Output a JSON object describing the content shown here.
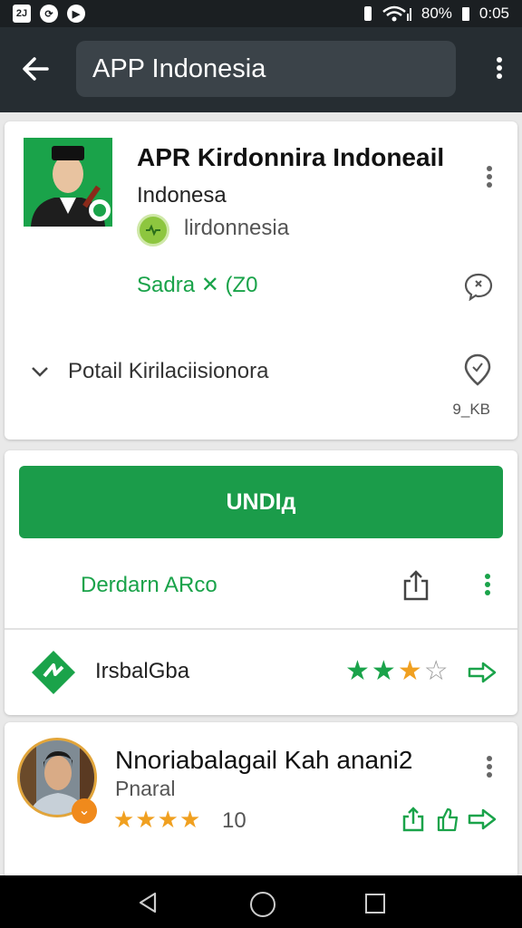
{
  "status_bar": {
    "left_icons": [
      "2J",
      "notification-icon",
      "play-icon"
    ],
    "battery": "80%",
    "time": "0:05"
  },
  "app_bar": {
    "search_value": "APP Indonesia"
  },
  "app_card": {
    "title": "APR Kirdonnira Indoneail",
    "subtitle": "Indonesa",
    "badge_label": "lirdonnesia",
    "green_text": "Sadra ✕ (Z0",
    "description": "Potail Kirilaciisionora",
    "size": "9_KB"
  },
  "install_card": {
    "install_label": "UNDIд",
    "green_link": "Derdarn ARco",
    "developer_name": "IrsbalGba",
    "rating_stars": 3,
    "rating_max": 5
  },
  "review_card": {
    "title": "Nnoriabalagail Kah anani2",
    "subtitle": "Pnaral",
    "rating_stars": 4,
    "rating_max": 5,
    "count": "10"
  },
  "colors": {
    "green": "#1b9c4a",
    "app_bar": "#262d32",
    "star": "#f0a020"
  }
}
